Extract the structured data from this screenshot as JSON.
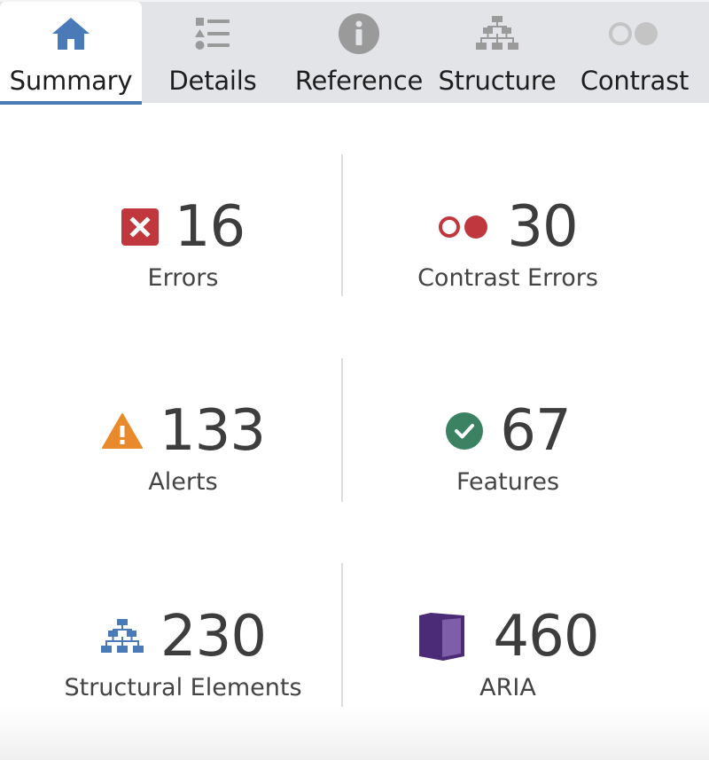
{
  "tabs": [
    {
      "id": "summary",
      "label": "Summary",
      "icon": "home-icon",
      "active": true
    },
    {
      "id": "details",
      "label": "Details",
      "icon": "list-icon",
      "active": false
    },
    {
      "id": "reference",
      "label": "Reference",
      "icon": "info-icon",
      "active": false
    },
    {
      "id": "structure",
      "label": "Structure",
      "icon": "hierarchy-icon",
      "active": false
    },
    {
      "id": "contrast",
      "label": "Contrast",
      "icon": "contrast-icon",
      "active": false
    }
  ],
  "summary": {
    "errors": {
      "count": "16",
      "label": "Errors",
      "icon": "error-x-icon",
      "color": "#c0383e"
    },
    "contrast_errors": {
      "count": "30",
      "label": "Contrast Errors",
      "icon": "contrast-error-icon",
      "color": "#c0383e"
    },
    "alerts": {
      "count": "133",
      "label": "Alerts",
      "icon": "alert-triangle-icon",
      "color": "#e8892b"
    },
    "features": {
      "count": "67",
      "label": "Features",
      "icon": "check-circle-icon",
      "color": "#3a8262"
    },
    "structural_elements": {
      "count": "230",
      "label": "Structural Elements",
      "icon": "hierarchy-icon",
      "color": "#4a7ab8"
    },
    "aria": {
      "count": "460",
      "label": "ARIA",
      "icon": "aria-cube-icon",
      "color": "#4b2a77"
    }
  },
  "colors": {
    "accent": "#4a7ab8",
    "tabbar_bg": "#e2e4e8",
    "inactive_icon": "#9a9a9a"
  }
}
